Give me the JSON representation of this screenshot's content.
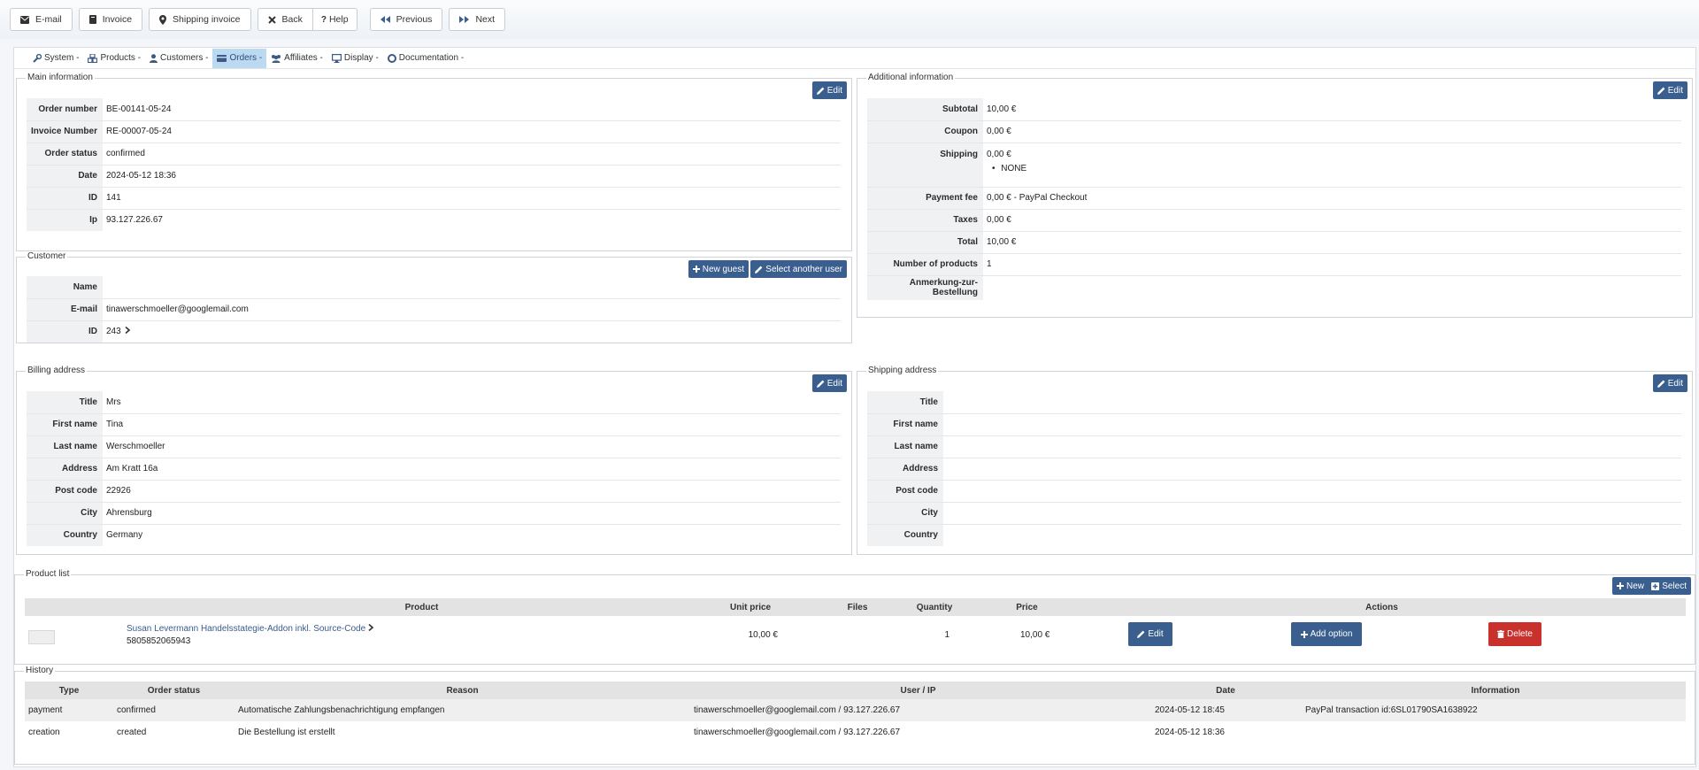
{
  "toolbar": {
    "email": "E-mail",
    "invoice": "Invoice",
    "shipping_invoice": "Shipping invoice",
    "back": "Back",
    "help": "Help",
    "previous": "Previous",
    "next": "Next"
  },
  "menu": {
    "system": "System -",
    "products": "Products -",
    "customers": "Customers -",
    "orders": "Orders -",
    "affiliates": "Affiliates -",
    "display": "Display -",
    "documentation": "Documentation -"
  },
  "main_info": {
    "legend": "Main information",
    "edit": "Edit",
    "rows": [
      {
        "k": "Order number",
        "v": "BE-00141-05-24"
      },
      {
        "k": "Invoice Number",
        "v": "RE-00007-05-24"
      },
      {
        "k": "Order status",
        "v": "confirmed"
      },
      {
        "k": "Date",
        "v": "2024-05-12 18:36"
      },
      {
        "k": "ID",
        "v": "141"
      },
      {
        "k": "Ip",
        "v": "93.127.226.67"
      }
    ]
  },
  "additional_info": {
    "legend": "Additional information",
    "edit": "Edit",
    "subtotal_k": "Subtotal",
    "subtotal_v": "10,00 €",
    "coupon_k": "Coupon",
    "coupon_v": "0,00 €",
    "shipping_k": "Shipping",
    "shipping_v": "0,00 €",
    "shipping_method": "NONE",
    "payment_fee_k": "Payment fee",
    "payment_fee_v": "0,00 € - PayPal Checkout",
    "taxes_k": "Taxes",
    "taxes_v": "0,00 €",
    "total_k": "Total",
    "total_v": "10,00 €",
    "num_products_k": "Number of products",
    "num_products_v": "1",
    "note_k": "Anmerkung-zur-Bestellung",
    "note_v": ""
  },
  "customer": {
    "legend": "Customer",
    "new_guest": "New guest",
    "select_user": "Select another user",
    "name_k": "Name",
    "name_v": "",
    "email_k": "E-mail",
    "email_v": "tinawerschmoeller@googlemail.com",
    "id_k": "ID",
    "id_v": "243"
  },
  "billing": {
    "legend": "Billing address",
    "edit": "Edit",
    "rows": [
      {
        "k": "Title",
        "v": "Mrs"
      },
      {
        "k": "First name",
        "v": "Tina"
      },
      {
        "k": "Last name",
        "v": "Werschmoeller"
      },
      {
        "k": "Address",
        "v": "Am Kratt 16a"
      },
      {
        "k": "Post code",
        "v": "22926"
      },
      {
        "k": "City",
        "v": "Ahrensburg"
      },
      {
        "k": "Country",
        "v": "Germany"
      }
    ]
  },
  "shipping": {
    "legend": "Shipping address",
    "edit": "Edit",
    "rows": [
      {
        "k": "Title",
        "v": ""
      },
      {
        "k": "First name",
        "v": ""
      },
      {
        "k": "Last name",
        "v": ""
      },
      {
        "k": "Address",
        "v": ""
      },
      {
        "k": "Post code",
        "v": ""
      },
      {
        "k": "City",
        "v": ""
      },
      {
        "k": "Country",
        "v": ""
      }
    ]
  },
  "product_list": {
    "legend": "Product list",
    "new": "New",
    "select": "Select",
    "headers": {
      "product": "Product",
      "unit_price": "Unit price",
      "files": "Files",
      "quantity": "Quantity",
      "price": "Price",
      "actions": "Actions"
    },
    "item": {
      "name": "Susan Levermann Handelsstategie-Addon inkl. Source-Code",
      "sku": "5805852065943",
      "unit_price": "10,00 €",
      "files": "",
      "quantity": "1",
      "price": "10,00 €",
      "edit": "Edit",
      "add_option": "Add option",
      "delete": "Delete"
    }
  },
  "history": {
    "legend": "History",
    "headers": {
      "type": "Type",
      "status": "Order status",
      "reason": "Reason",
      "user_ip": "User / IP",
      "date": "Date",
      "information": "Information"
    },
    "rows": [
      {
        "type": "payment",
        "status": "confirmed",
        "reason": "Automatische Zahlungsbenachrichtigung empfangen",
        "user_ip": "tinawerschmoeller@googlemail.com / 93.127.226.67",
        "date": "2024-05-12 18:45",
        "information": "PayPal transaction id:6SL01790SA1638922"
      },
      {
        "type": "creation",
        "status": "created",
        "reason": "Die Bestellung ist erstellt",
        "user_ip": "tinawerschmoeller@googlemail.com / 93.127.226.67",
        "date": "2024-05-12 18:36",
        "information": ""
      }
    ]
  }
}
